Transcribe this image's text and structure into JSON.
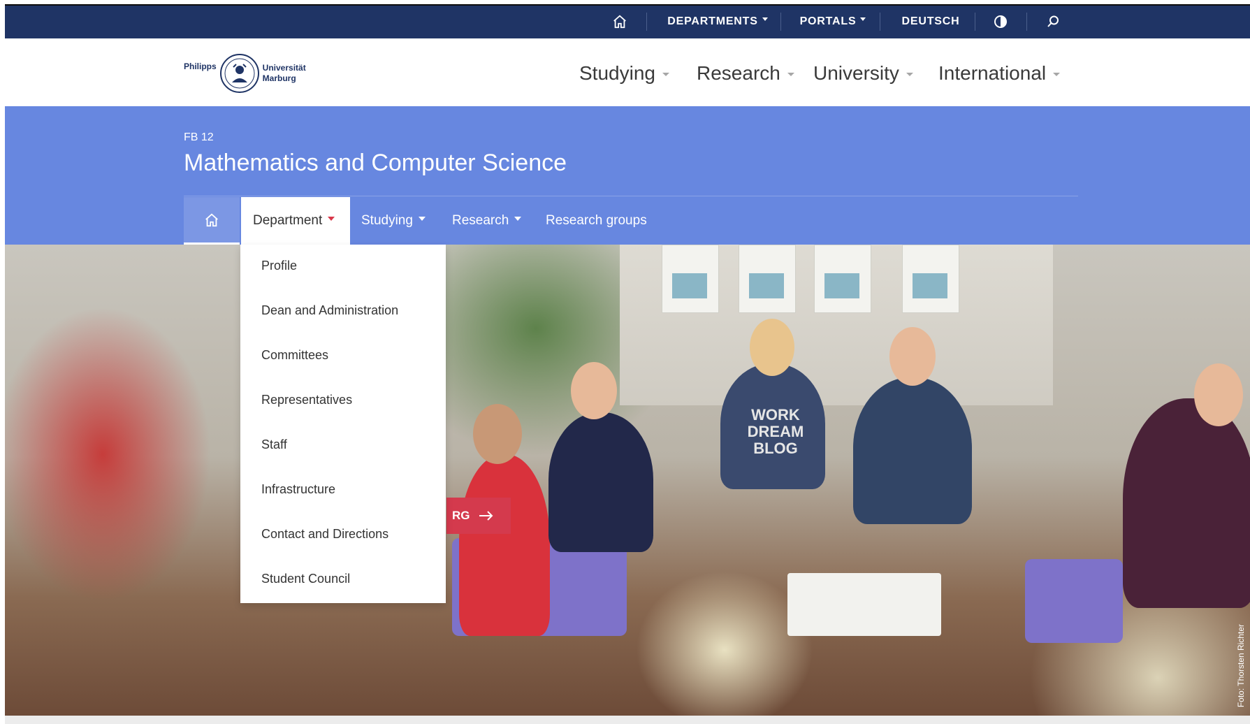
{
  "topbar": {
    "home_icon": "home-icon",
    "departments": "DEPARTMENTS",
    "portals": "PORTALS",
    "language": "DEUTSCH",
    "contrast_icon": "contrast-icon",
    "search_icon": "search-icon"
  },
  "logo": {
    "left_text": "Philipps",
    "right_line1": "Universität",
    "right_line2": "Marburg"
  },
  "mainnav": {
    "studying": "Studying",
    "research": "Research",
    "university": "University",
    "international": "International"
  },
  "band": {
    "eyebrow": "FB 12",
    "title": "Mathematics and Computer Science"
  },
  "subnav": {
    "home_icon": "home-icon",
    "department": "Department",
    "studying": "Studying",
    "research": "Research",
    "research_groups": "Research groups"
  },
  "dropdown": {
    "items": [
      "Profile",
      "Dean and Administration",
      "Committees",
      "Representatives",
      "Staff",
      "Infrastructure",
      "Contact and Directions",
      "Student Council"
    ]
  },
  "hero": {
    "cta_text": "RG",
    "cta_icon": "arrow-right-icon",
    "shirt_text_1": "WORK",
    "shirt_text_2": "DREAM",
    "shirt_text_3": "BLOG",
    "credit": "Foto: Thorsten Richter"
  },
  "colors": {
    "topbar": "#1f3465",
    "band": "#6787e0",
    "accent_red": "#d43a4d"
  }
}
